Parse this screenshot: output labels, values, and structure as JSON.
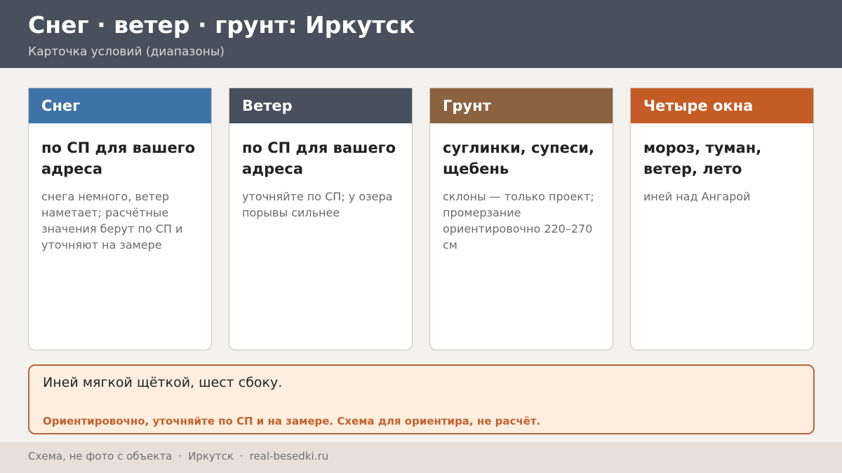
{
  "header": {
    "title": "Снег · ветер · грунт: Иркутск",
    "subtitle": "Карточка условий (диапазоны)"
  },
  "cards": [
    {
      "heading": "Снег",
      "color": "#3f74a8",
      "main": "по СП для вашего адреса",
      "note": "снега немного, ветер наметает; расчётные значения берут по СП и уточняют на замере"
    },
    {
      "heading": "Ветер",
      "color": "#47505c",
      "main": "по СП для вашего адреса",
      "note": "уточняйте по СП; у озера порывы сильнее"
    },
    {
      "heading": "Грунт",
      "color": "#8b6340",
      "main": "суглинки, супеси, щебень",
      "note": "склоны — только проект; промерзание ориентировочно 220–270 см"
    },
    {
      "heading": "Четыре окна",
      "color": "#c45c26",
      "main": "мороз, туман, ветер, лето",
      "note": "иней над Ангарой"
    }
  ],
  "note": {
    "main": "Иней мягкой щёткой, шест сбоку.",
    "warning": "Ориентировочно, уточняйте по СП и на замере. Схема для ориентира, не расчёт."
  },
  "footer": {
    "source": "Схема, не фото с объекта",
    "separator": "·",
    "city": "Иркутск",
    "site": "real-besedki.ru"
  }
}
